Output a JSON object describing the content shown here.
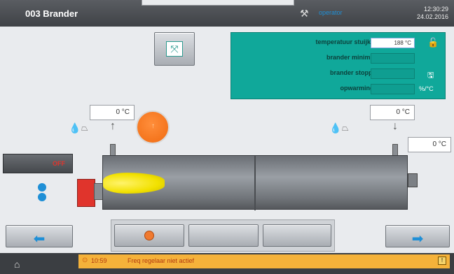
{
  "header": {
    "title": "003 Brander",
    "user": "operator",
    "time": "12:30:29",
    "date": "24.02.2016"
  },
  "panel": {
    "rows": [
      {
        "label": "temperatuur stuijkien",
        "value": "188 °C",
        "unit": ""
      },
      {
        "label": "brander minimum",
        "value": "",
        "unit": ""
      },
      {
        "label": "brander stoppen",
        "value": "",
        "unit": ""
      },
      {
        "label": "opwarming P",
        "value": "",
        "unit": "%/°C"
      }
    ]
  },
  "temps": {
    "left": "0 °C",
    "right_top": "0 °C",
    "right_side": "0 °C"
  },
  "switch": {
    "label": "OFF"
  },
  "status": {
    "time": "10:59",
    "message": "Freq regelaar niet actief"
  },
  "colors": {
    "accent": "#1f8fd6",
    "panel": "#10a89a",
    "flame": "#f2e100",
    "fan": "#f06a10",
    "status": "#f5b23a"
  }
}
